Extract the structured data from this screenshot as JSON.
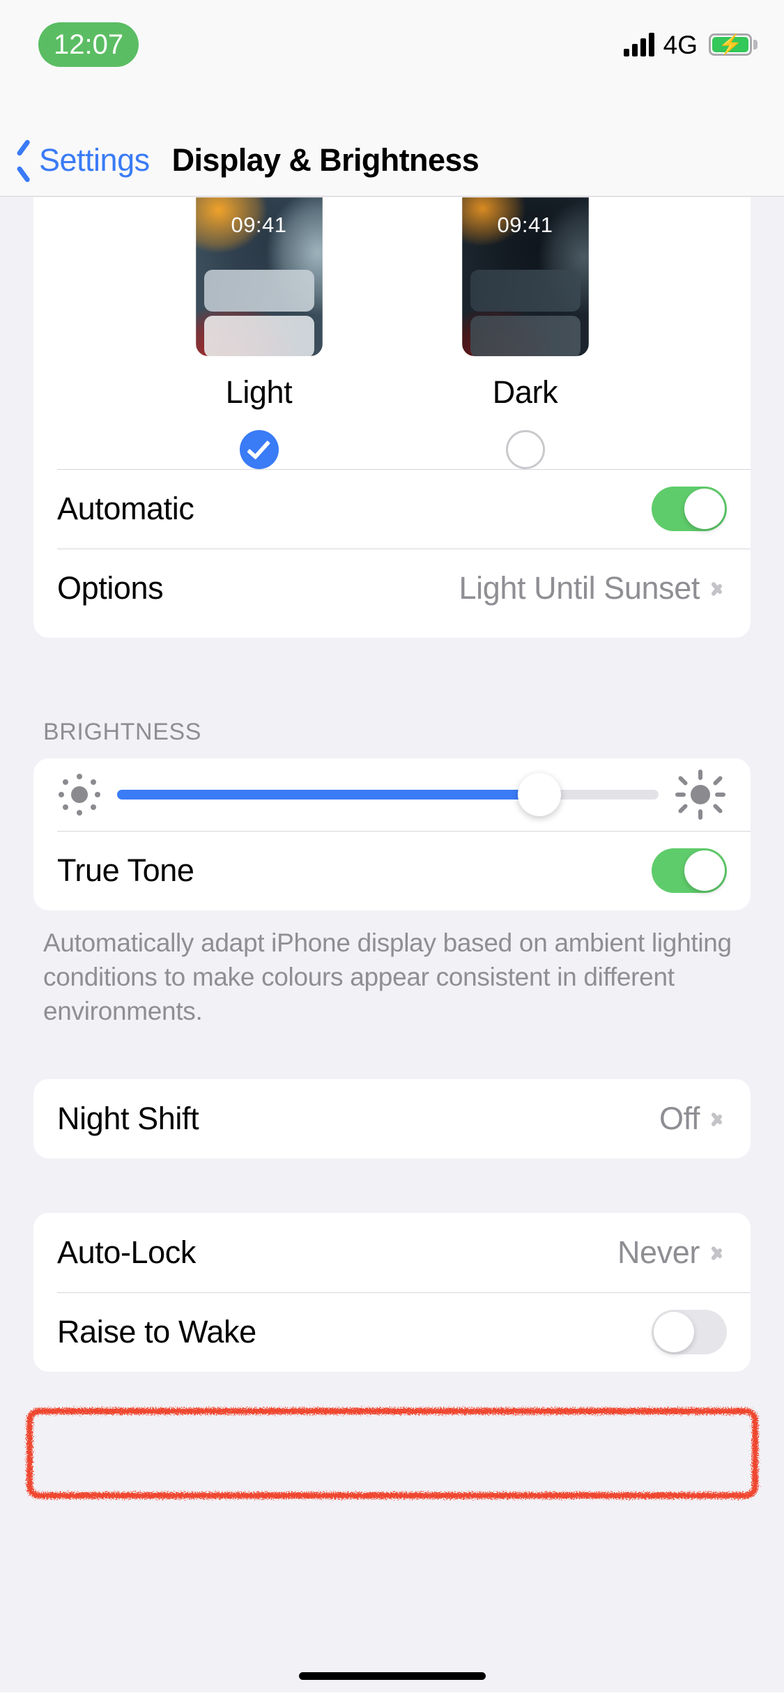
{
  "status_bar": {
    "time": "12:07",
    "network": "4G",
    "signal_icon": "signal-bars-icon",
    "battery_icon": "battery-charging-icon",
    "time_pill_color": "#5bbd63"
  },
  "nav_bar": {
    "back_label": "Settings",
    "back_icon": "chevron-left-icon",
    "title": "Display & Brightness",
    "accent_color": "#3a7bf6"
  },
  "appearance": {
    "modes": [
      {
        "label": "Light",
        "preview_time": "09:41",
        "selected": true
      },
      {
        "label": "Dark",
        "preview_time": "09:41",
        "selected": false
      }
    ],
    "automatic": {
      "label": "Automatic",
      "enabled": true
    },
    "options": {
      "label": "Options",
      "value": "Light Until Sunset",
      "chevron": "chevron-right-icon"
    }
  },
  "brightness": {
    "header": "BRIGHTNESS",
    "slider": {
      "low_icon": "sun-low-icon",
      "high_icon": "sun-high-icon",
      "value_percent": 78
    },
    "true_tone": {
      "label": "True Tone",
      "enabled": true
    },
    "footer": "Automatically adapt iPhone display based on ambient lighting conditions to make colours appear consistent in different environments."
  },
  "night_shift": {
    "label": "Night Shift",
    "value": "Off",
    "chevron": "chevron-right-icon"
  },
  "lock_section": {
    "auto_lock": {
      "label": "Auto-Lock",
      "value": "Never",
      "chevron": "chevron-right-icon",
      "highlighted": true
    },
    "raise_to_wake": {
      "label": "Raise to Wake",
      "enabled": false
    }
  },
  "annotation": {
    "color": "#ef3b20",
    "target": "auto-lock-row"
  },
  "home_indicator": "home-indicator"
}
